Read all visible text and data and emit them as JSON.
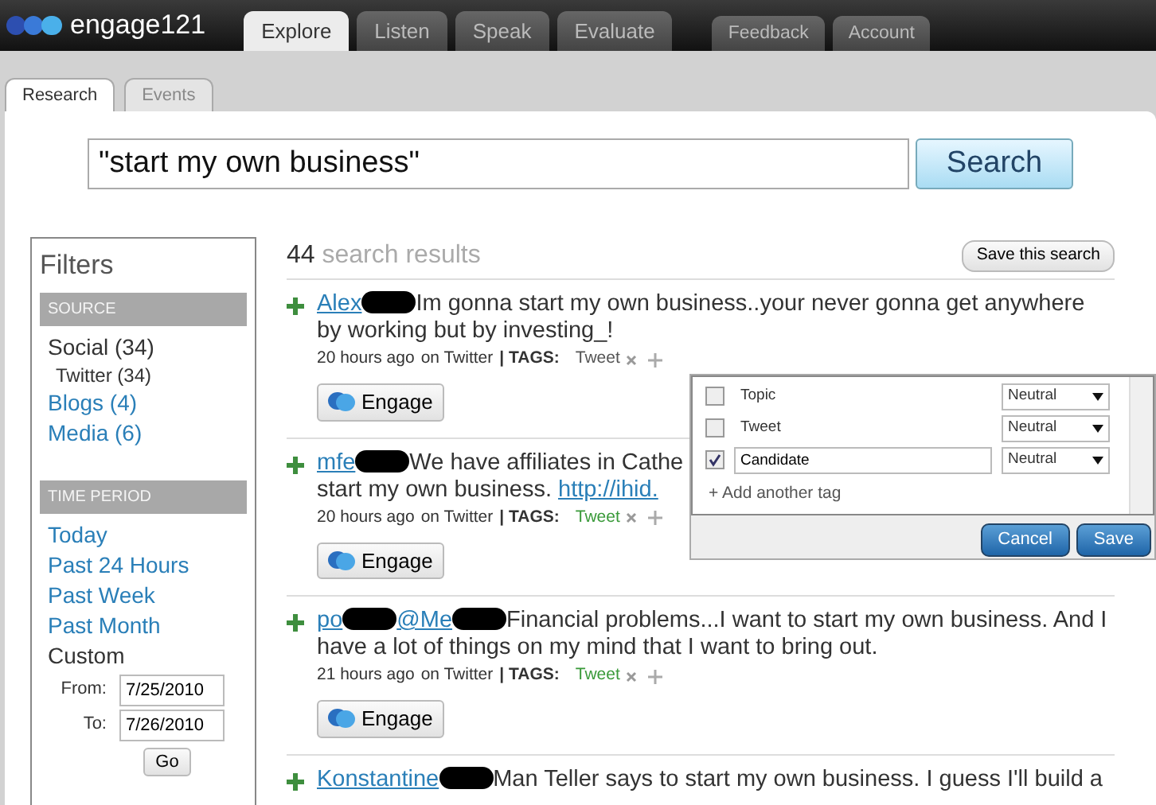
{
  "brand": "engage121",
  "main_tabs": [
    {
      "label": "Explore",
      "selected": true
    },
    {
      "label": "Listen",
      "selected": false
    },
    {
      "label": "Speak",
      "selected": false
    },
    {
      "label": "Evaluate",
      "selected": false
    }
  ],
  "account_tabs": [
    "Feedback",
    "Account"
  ],
  "sub_tabs": [
    {
      "label": "Research",
      "selected": true
    },
    {
      "label": "Events",
      "selected": false
    }
  ],
  "search": {
    "value": "\"start my own business\"",
    "button": "Search"
  },
  "filters": {
    "title": "Filters",
    "sections": [
      {
        "heading": "SOURCE",
        "items": [
          {
            "label": "Social (34)",
            "kind": "plain",
            "children": [
              {
                "label": "Twitter (34)",
                "kind": "plain"
              }
            ]
          },
          {
            "label": "Blogs (4)",
            "kind": "link"
          },
          {
            "label": "Media (6)",
            "kind": "link"
          }
        ]
      },
      {
        "heading": "TIME PERIOD",
        "items": [
          {
            "label": "Today",
            "kind": "link"
          },
          {
            "label": "Past 24 Hours",
            "kind": "link"
          },
          {
            "label": "Past Week",
            "kind": "link"
          },
          {
            "label": "Past Month",
            "kind": "link"
          },
          {
            "label": "Custom",
            "kind": "plain"
          }
        ]
      }
    ],
    "from_label": "From:",
    "from": "7/25/2010",
    "to_label": "To:",
    "to": "7/26/2010",
    "go": "Go"
  },
  "results": {
    "count": "44",
    "label": "search results",
    "save_button": "Save this search",
    "items": [
      {
        "author": "Alex",
        "text": "Im gonna start my own business..your never gonna get anywhere by working but by investing_!",
        "time": "20 hours ago",
        "source": "on Twitter",
        "tags_label": "| TAGS:",
        "tags": [
          {
            "label": "Tweet",
            "highlighted": false
          }
        ],
        "engage": "Engage"
      },
      {
        "author": "mfe",
        "text": "We have affiliates in Cathe",
        "link_prefix": "start my own business.",
        "link": "http://ihid.",
        "time": "20 hours ago",
        "source": "on Twitter",
        "tags_label": "| TAGS:",
        "tags": [
          {
            "label": "Tweet",
            "highlighted": true
          }
        ],
        "engage": "Engage"
      },
      {
        "author": "po",
        "mention": "@Me",
        "text": "Financial problems...I want to start my own business. And I have a lot of things on my mind that I want to bring out.",
        "time": "21 hours ago",
        "source": "on Twitter",
        "tags_label": "| TAGS:",
        "tags": [
          {
            "label": "Tweet",
            "highlighted": true
          }
        ],
        "engage": "Engage"
      },
      {
        "author": "Konstantine",
        "text": "Man Teller says to start my own business. I guess I'll build a"
      }
    ]
  },
  "tag_popup": {
    "rows": [
      {
        "label": "Topic",
        "checked": false,
        "editable": false,
        "sentiment": "Neutral"
      },
      {
        "label": "Tweet",
        "checked": false,
        "editable": false,
        "sentiment": "Neutral"
      },
      {
        "label": "Candidate",
        "checked": true,
        "editable": true,
        "sentiment": "Neutral"
      }
    ],
    "add_tag": "+ Add another tag",
    "cancel": "Cancel",
    "save": "Save"
  }
}
